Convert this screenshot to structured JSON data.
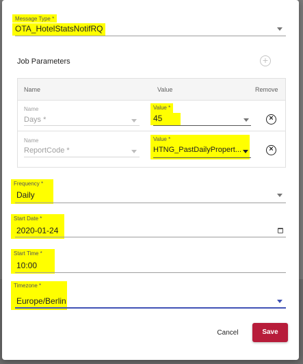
{
  "dialog": {
    "message_type": {
      "label": "Message Type *",
      "value": "OTA_HotelStatsNotifRQ"
    },
    "job_parameters": {
      "title": "Job Parameters",
      "add_icon": "plus-circle-icon",
      "headers": {
        "name": "Name",
        "value": "Value",
        "remove": "Remove"
      },
      "rows": [
        {
          "name_label": "Name",
          "name_value": "Days *",
          "value_label": "Value *",
          "value_value": "45"
        },
        {
          "name_label": "Name",
          "name_value": "ReportCode *",
          "value_label": "Value *",
          "value_value": "HTNG_PastDailyPropert..."
        }
      ]
    },
    "frequency": {
      "label": "Frequency *",
      "value": "Daily"
    },
    "start_date": {
      "label": "Start Date *",
      "value": "2020-01-24"
    },
    "start_time": {
      "label": "Start Time *",
      "value": "10:00"
    },
    "timezone": {
      "label": "Timezone *",
      "value": "Europe/Berlin"
    },
    "actions": {
      "cancel": "Cancel",
      "save": "Save"
    }
  },
  "colors": {
    "highlight": "#ffff00",
    "save_button": "#b71c3a",
    "active_underline": "#3f51b5",
    "backdrop": "#7a7a7a"
  }
}
